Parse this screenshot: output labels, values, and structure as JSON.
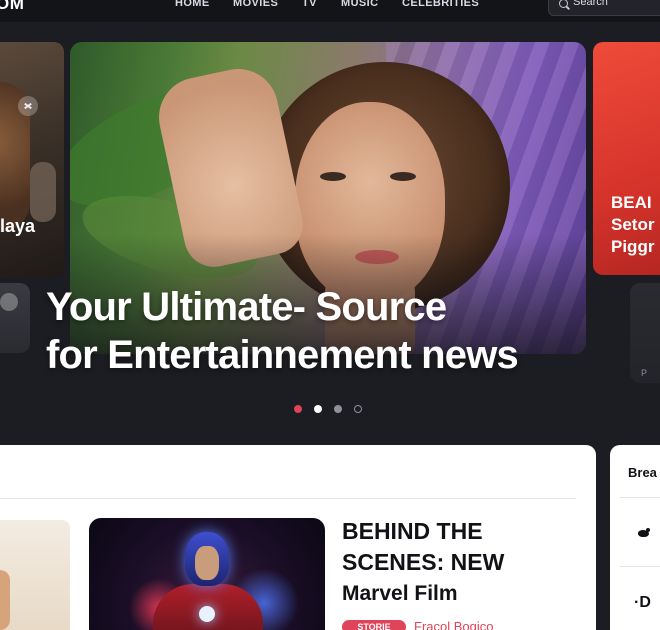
{
  "nav": {
    "logo": "OM",
    "links": [
      "HOME",
      "MOVIES",
      "TV",
      "MUSIC",
      "CELEBRITIES"
    ],
    "search_placeholder": "Search"
  },
  "carousel": {
    "left_card_label": "laya",
    "right_card_label": [
      "BEAI",
      "Setor",
      "Piggr"
    ],
    "right_bottom_text": "P",
    "hero_title": [
      "Your Ultimate- Source",
      "for Entertainnement news"
    ],
    "active_slide": 1,
    "slide_count": 4
  },
  "article": {
    "title": [
      "BEHIND THE",
      "SCENES: NEW",
      "Marvel Film"
    ],
    "badge": "STORIE",
    "author": "Fracol Bogico"
  },
  "sidebar": {
    "title": "Brea",
    "glyph": "·D"
  },
  "colors": {
    "accent": "#e0445a",
    "page_bg": "#1c1d22",
    "nav_bg": "#131418"
  },
  "icons": [
    "search-icon",
    "share-icon",
    "twitter-icon"
  ]
}
